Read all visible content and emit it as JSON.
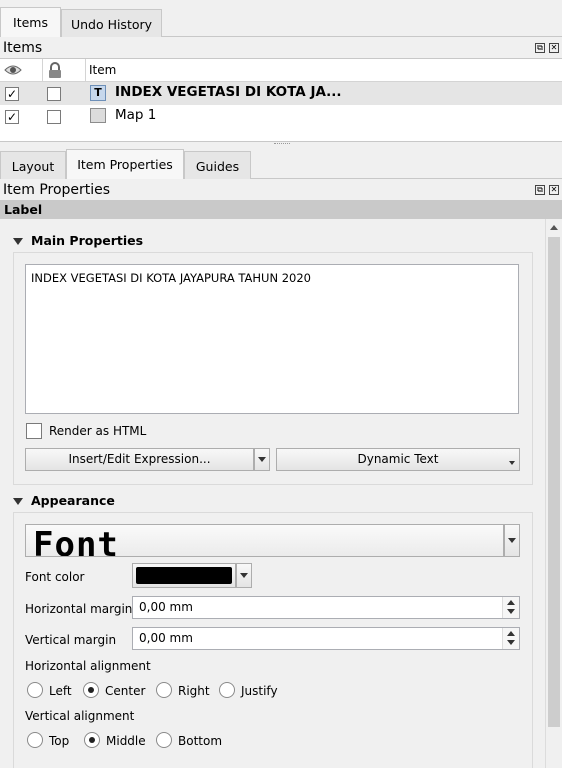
{
  "top_tabs": [
    {
      "label": "Items",
      "active": true
    },
    {
      "label": "Undo History",
      "active": false
    }
  ],
  "items_panel": {
    "title": "Items",
    "column_item": "Item",
    "rows": [
      {
        "label": "INDEX VEGETASI DI KOTA JA...",
        "visible": "✓",
        "locked": "",
        "icon": "text-label-icon",
        "bold": true,
        "selected": true
      },
      {
        "label": "Map 1",
        "visible": "✓",
        "locked": "",
        "icon": "map-item-icon",
        "bold": false,
        "selected": false
      }
    ]
  },
  "middle_tabs": [
    {
      "label": "Layout",
      "active": false
    },
    {
      "label": "Item Properties",
      "active": true
    },
    {
      "label": "Guides",
      "active": false
    }
  ],
  "properties_panel": {
    "title": "Item Properties",
    "section": "Label",
    "main_properties": {
      "title": "Main Properties",
      "text": "INDEX VEGETASI DI KOTA JAYAPURA TAHUN 2020",
      "render_html_label": "Render as HTML",
      "render_html_checked": false,
      "insert_expression_label": "Insert/Edit Expression...",
      "dynamic_text_label": "Dynamic Text"
    },
    "appearance": {
      "title": "Appearance",
      "font_button_label": "Font",
      "font_color_label": "Font color",
      "font_color_value": "#000000",
      "horizontal_margin_label": "Horizontal margin",
      "horizontal_margin_value": "0,00 mm",
      "vertical_margin_label": "Vertical margin",
      "vertical_margin_value": "0,00 mm",
      "horizontal_alignment_label": "Horizontal alignment",
      "horizontal_alignment_options": [
        "Left",
        "Center",
        "Right",
        "Justify"
      ],
      "horizontal_alignment_selected": "Center",
      "vertical_alignment_label": "Vertical alignment",
      "vertical_alignment_options": [
        "Top",
        "Middle",
        "Bottom"
      ],
      "vertical_alignment_selected": "Middle"
    }
  }
}
